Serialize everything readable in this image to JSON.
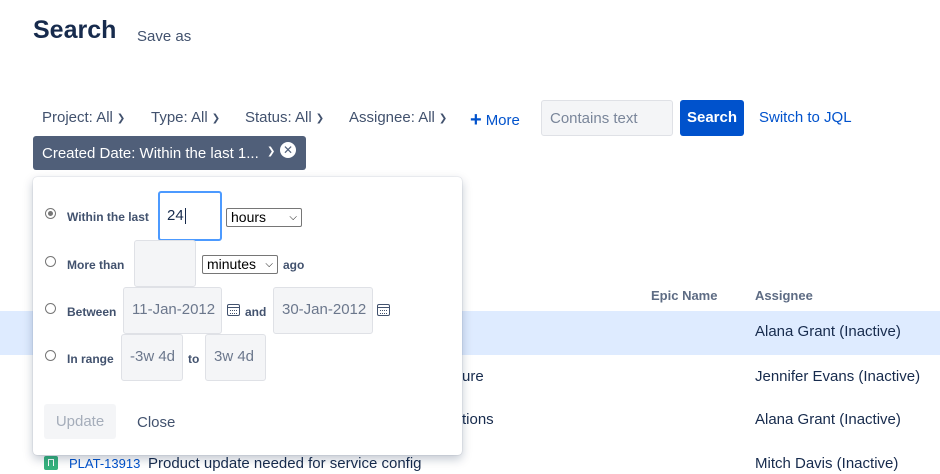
{
  "header": {
    "title": "Search",
    "save_as": "Save as"
  },
  "filters": {
    "project": "Project: All",
    "type": "Type: All",
    "status": "Status: All",
    "assignee": "Assignee: All",
    "more": "More",
    "contains_placeholder": "Contains text",
    "search_button": "Search",
    "switch_jql": "Switch to JQL",
    "chip_label": "Created Date: Within the last 1..."
  },
  "table": {
    "headers": {
      "epic_name": "Epic Name",
      "assignee": "Assignee"
    },
    "rows": [
      {
        "summary_fragment": "",
        "assignee": "Alana Grant (Inactive)"
      },
      {
        "summary_fragment": "ure",
        "assignee": "Jennifer Evans (Inactive)"
      },
      {
        "summary_fragment": "tions",
        "assignee": "Alana Grant (Inactive)"
      },
      {
        "key": "PLAT-13913",
        "summary": "Product update needed for service config",
        "assignee": "Mitch Davis (Inactive)"
      }
    ]
  },
  "date_popup": {
    "within": {
      "label": "Within the last",
      "value": "24",
      "unit": "hours"
    },
    "more_than": {
      "label": "More than",
      "value": "",
      "unit": "minutes",
      "suffix": "ago"
    },
    "between": {
      "label": "Between",
      "from": "11-Jan-2012",
      "and": "and",
      "to": "30-Jan-2012"
    },
    "in_range": {
      "label": "In range",
      "from": "-3w 4d",
      "to_label": "to",
      "to": "3w 4d"
    },
    "update_button": "Update",
    "close_button": "Close"
  }
}
